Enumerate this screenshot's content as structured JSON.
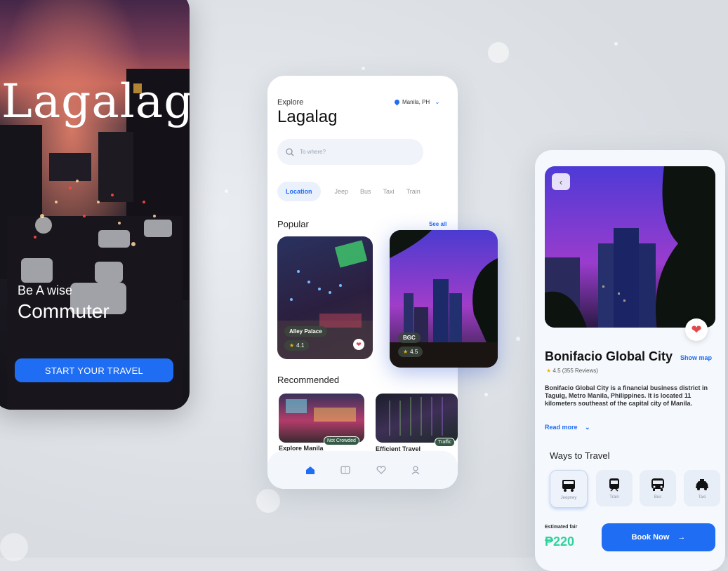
{
  "splash": {
    "title": "Lagalag",
    "subtitle1": "Be A wise",
    "subtitle2": "Commuter",
    "cta": "START YOUR TRAVEL"
  },
  "explore": {
    "kicker": "Explore",
    "title": "Lagalag",
    "location": "Manila, PH",
    "search_placeholder": "To where?",
    "tabs": [
      "Location",
      "Jeep",
      "Bus",
      "Taxi",
      "Train"
    ],
    "popular_title": "Popular",
    "see_all": "See all",
    "popular": [
      {
        "name": "Alley Palace",
        "rating": "4.1"
      },
      {
        "name": "BGC",
        "rating": "4.5"
      }
    ],
    "recommended_title": "Recommended",
    "recommended": [
      {
        "name": "Explore Manila",
        "tag": "Not Crowded"
      },
      {
        "name": "Efficient Travel",
        "tag": "Traffic"
      }
    ],
    "nav": [
      "home-icon",
      "ticket-icon",
      "heart-icon",
      "user-icon"
    ]
  },
  "detail": {
    "title": "Bonifacio Global City",
    "show_map": "Show map",
    "rating": "4.5 (355 Reviews)",
    "description": "Bonifacio Global City is a financial business district in Taguig, Metro Manila, Philippines. It is located 11 kilometers southeast of the capital city of Manila.",
    "read_more": "Read more",
    "ways_title": "Ways to Travel",
    "ways": [
      {
        "label": "Jeepney",
        "icon": "jeepney-icon"
      },
      {
        "label": "Train",
        "icon": "train-icon"
      },
      {
        "label": "Bus",
        "icon": "bus-icon"
      },
      {
        "label": "Taxi",
        "icon": "taxi-icon"
      }
    ],
    "fare_label": "Estimated fair",
    "fare": "₱220",
    "book": "Book Now"
  },
  "colors": {
    "accent": "#1f6df2",
    "fare": "#2fd39a",
    "heart": "#e24a4a"
  }
}
